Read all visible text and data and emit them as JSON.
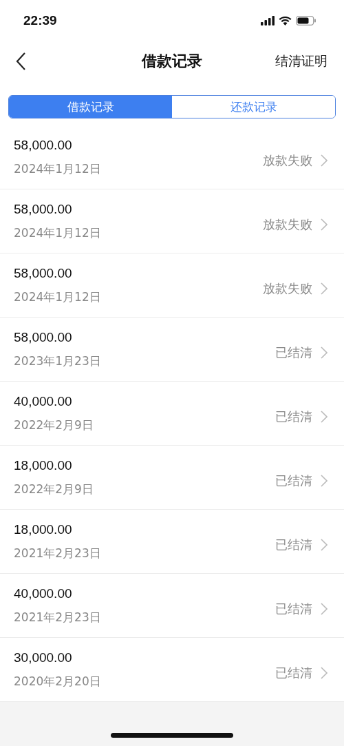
{
  "status_bar": {
    "time": "22:39"
  },
  "nav": {
    "title": "借款记录",
    "action": "结清证明"
  },
  "tabs": [
    {
      "label": "借款记录",
      "selected": true
    },
    {
      "label": "还款记录",
      "selected": false
    }
  ],
  "records": [
    {
      "amount": "58,000.00",
      "date": "2024年1月12日",
      "status": "放款失败"
    },
    {
      "amount": "58,000.00",
      "date": "2024年1月12日",
      "status": "放款失败"
    },
    {
      "amount": "58,000.00",
      "date": "2024年1月12日",
      "status": "放款失败"
    },
    {
      "amount": "58,000.00",
      "date": "2023年1月23日",
      "status": "已结清"
    },
    {
      "amount": "40,000.00",
      "date": "2022年2月9日",
      "status": "已结清"
    },
    {
      "amount": "18,000.00",
      "date": "2022年2月9日",
      "status": "已结清"
    },
    {
      "amount": "18,000.00",
      "date": "2021年2月23日",
      "status": "已结清"
    },
    {
      "amount": "40,000.00",
      "date": "2021年2月23日",
      "status": "已结清"
    },
    {
      "amount": "30,000.00",
      "date": "2020年2月20日",
      "status": "已结清"
    }
  ]
}
